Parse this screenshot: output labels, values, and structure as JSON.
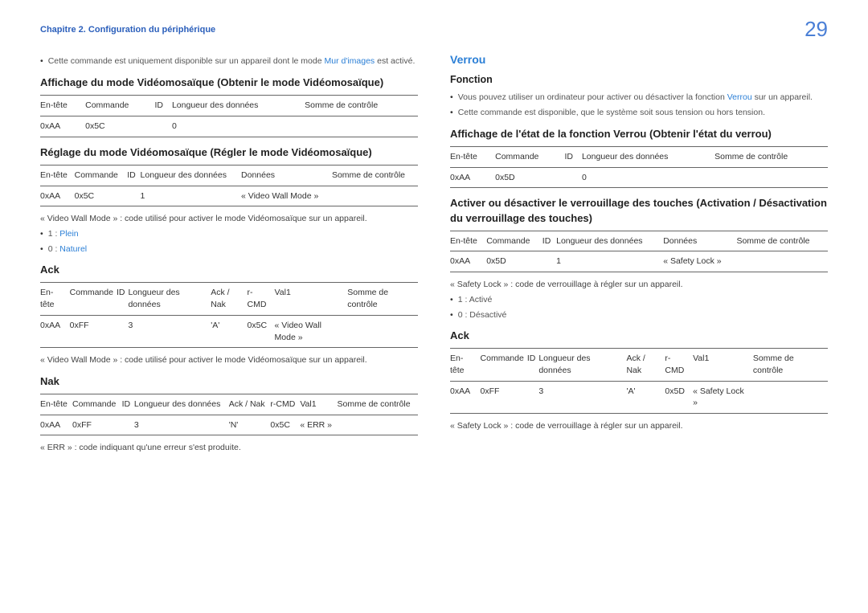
{
  "chapter": "Chapitre 2. Configuration du périphérique",
  "pageNum": "29",
  "left": {
    "intro1a": "Cette commande est uniquement disponible sur un appareil dont le mode ",
    "intro1link": "Mur d'images",
    "intro1b": " est activé.",
    "h1": "Affichage du mode Vidéomosaïque (Obtenir le mode Vidéomosaïque)",
    "t1h": [
      "En-tête",
      "Commande",
      "ID",
      "Longueur des données",
      "Somme de contrôle"
    ],
    "t1r": [
      "0xAA",
      "0x5C",
      "",
      "0",
      ""
    ],
    "h2": "Réglage du mode Vidéomosaïque (Régler le mode Vidéomosaïque)",
    "t2h": [
      "En-tête",
      "Commande",
      "ID",
      "Longueur des données",
      "Données",
      "Somme de contrôle"
    ],
    "t2r": [
      "0xAA",
      "0x5C",
      "",
      "1",
      "« Video Wall Mode »",
      ""
    ],
    "note1": "« Video Wall Mode » : code utilisé pour activer le mode Vidéomosaïque sur un appareil.",
    "b1a": "1 : ",
    "b1b": "Plein",
    "b2a": "0 : ",
    "b2b": "Naturel",
    "hAck": "Ack",
    "t3h": [
      "En-tête",
      "Commande",
      "ID",
      "Longueur des données",
      "Ack / Nak",
      "r-CMD",
      "Val1",
      "Somme de contrôle"
    ],
    "t3r": [
      "0xAA",
      "0xFF",
      "",
      "3",
      "'A'",
      "0x5C",
      "« Video Wall Mode »",
      ""
    ],
    "note2": "« Video Wall Mode » : code utilisé pour activer le mode Vidéomosaïque sur un appareil.",
    "hNak": "Nak",
    "t4h": [
      "En-tête",
      "Commande",
      "ID",
      "Longueur des données",
      "Ack / Nak",
      "r-CMD",
      "Val1",
      "Somme de contrôle"
    ],
    "t4r": [
      "0xAA",
      "0xFF",
      "",
      "3",
      "'N'",
      "0x5C",
      "« ERR »",
      ""
    ],
    "note3": "« ERR » : code indiquant qu'une erreur s'est produite."
  },
  "right": {
    "hSec": "Verrou",
    "hFn": "Fonction",
    "intro1a": "Vous pouvez utiliser un ordinateur pour activer ou désactiver la fonction ",
    "intro1link": "Verrou",
    "intro1b": " sur un appareil.",
    "intro2": "Cette commande est disponible, que le système soit sous tension ou hors tension.",
    "h1": "Affichage de l'état de la fonction Verrou (Obtenir l'état du verrou)",
    "t1h": [
      "En-tête",
      "Commande",
      "ID",
      "Longueur des données",
      "Somme de contrôle"
    ],
    "t1r": [
      "0xAA",
      "0x5D",
      "",
      "0",
      ""
    ],
    "h2": "Activer ou désactiver le verrouillage des touches (Activation / Désactivation du verrouillage des touches)",
    "t2h": [
      "En-tête",
      "Commande",
      "ID",
      "Longueur des données",
      "Données",
      "Somme de contrôle"
    ],
    "t2r": [
      "0xAA",
      "0x5D",
      "",
      "1",
      "« Safety Lock »",
      ""
    ],
    "note1": "« Safety Lock » : code de verrouillage à régler sur un appareil.",
    "b1": "1 : Activé",
    "b2": "0 : Désactivé",
    "hAck": "Ack",
    "t3h": [
      "En-tête",
      "Commande",
      "ID",
      "Longueur des données",
      "Ack / Nak",
      "r-CMD",
      "Val1",
      "Somme de contrôle"
    ],
    "t3r": [
      "0xAA",
      "0xFF",
      "",
      "3",
      "'A'",
      "0x5D",
      "« Safety Lock »",
      ""
    ],
    "note2": "« Safety Lock » : code de verrouillage à régler sur un appareil."
  }
}
